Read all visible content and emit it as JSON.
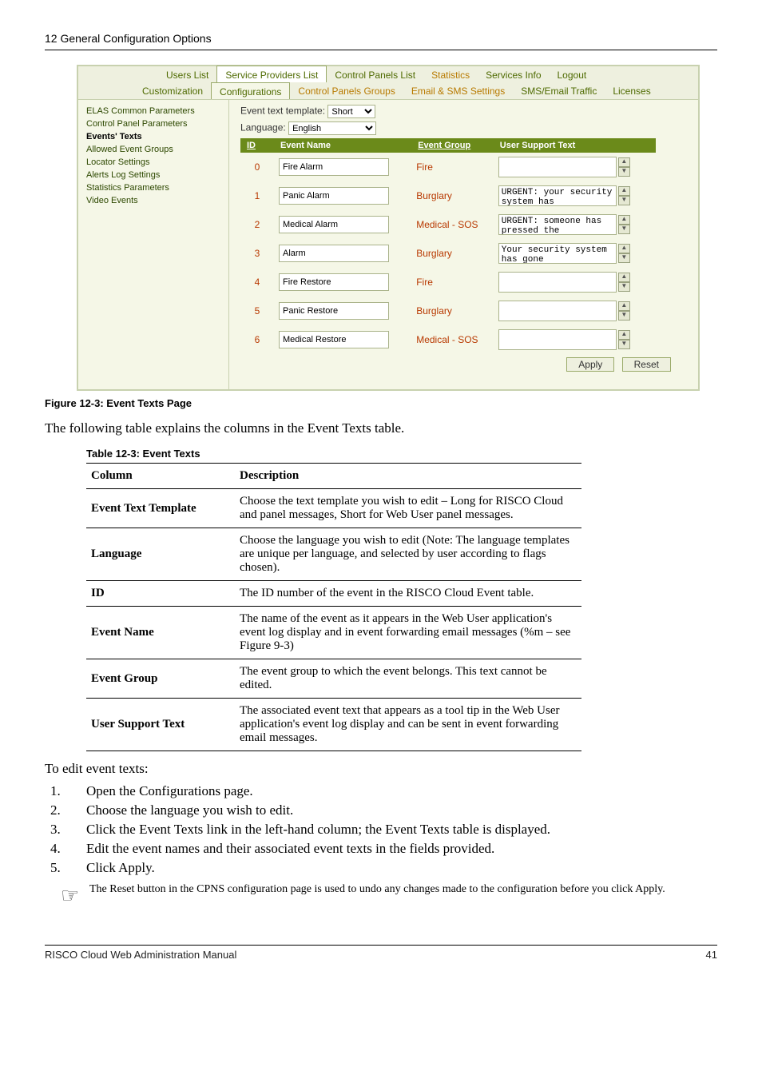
{
  "header": "12 General Configuration Options",
  "screenshot": {
    "tabs_row1": [
      "Users List",
      "Service Providers List",
      "Control Panels List",
      "Statistics",
      "Services Info",
      "Logout"
    ],
    "tabs_row2": [
      "Customization",
      "Configurations",
      "Control Panels Groups",
      "Email & SMS Settings",
      "SMS/Email Traffic",
      "Licenses"
    ],
    "sidebar": [
      {
        "label": "ELAS Common Parameters",
        "cls": ""
      },
      {
        "label": "Control Panel Parameters",
        "cls": ""
      },
      {
        "label": "Events' Texts",
        "cls": "bold"
      },
      {
        "label": "Allowed Event Groups",
        "cls": ""
      },
      {
        "label": "Locator Settings",
        "cls": ""
      },
      {
        "label": "Alerts Log Settings",
        "cls": ""
      },
      {
        "label": "Statistics Parameters",
        "cls": ""
      },
      {
        "label": "Video Events",
        "cls": ""
      }
    ],
    "template_label": "Event text template:",
    "template_value": "Short",
    "language_label": "Language:",
    "language_value": "English",
    "headers": {
      "id": "ID",
      "name": "Event Name",
      "group": "Event Group",
      "support": "User Support Text"
    },
    "rows": [
      {
        "id": "0",
        "name": "Fire Alarm",
        "group": "Fire",
        "support": ""
      },
      {
        "id": "1",
        "name": "Panic Alarm",
        "group": "Burglary",
        "support": "URGENT:  your security system has"
      },
      {
        "id": "2",
        "name": "Medical Alarm",
        "group": "Medical - SOS",
        "support": "URGENT:  someone has pressed the"
      },
      {
        "id": "3",
        "name": "Alarm",
        "group": "Burglary",
        "support": "Your security system has gone"
      },
      {
        "id": "4",
        "name": "Fire Restore",
        "group": "Fire",
        "support": ""
      },
      {
        "id": "5",
        "name": "Panic Restore",
        "group": "Burglary",
        "support": ""
      },
      {
        "id": "6",
        "name": "Medical Restore",
        "group": "Medical - SOS",
        "support": ""
      }
    ],
    "apply": "Apply",
    "reset": "Reset"
  },
  "fig_caption": "Figure 12-3: Event Texts Page",
  "intro": "The following table explains the columns in the Event Texts table.",
  "tbl_caption": "Table 12-3: Event Texts",
  "doc_table": {
    "h1": "Column",
    "h2": "Description",
    "rows": [
      {
        "c": "Event Text Template",
        "d": "Choose the text template you wish to edit – Long for RISCO Cloud and panel messages, Short for Web User panel messages."
      },
      {
        "c": "Language",
        "d": "Choose the language you wish to edit (Note: The language templates are unique per language, and selected by user according to flags chosen)."
      },
      {
        "c": "ID",
        "d": "The ID number of the event in the RISCO Cloud Event table."
      },
      {
        "c": "Event Name",
        "d": "The name of the event as it appears in the Web User application's event log display and in event forwarding email messages (%m – see Figure 9-3)"
      },
      {
        "c": "Event Group",
        "d": "The event group to which the event belongs. This text cannot be edited."
      },
      {
        "c": "User Support Text",
        "d": "The associated event text that appears as a tool tip in the Web User application's event log display and can be sent in event forwarding email messages."
      }
    ]
  },
  "steps_heading": "To edit event texts:",
  "steps": [
    "Open the Configurations page.",
    "Choose the language you wish to edit.",
    "Click the Event Texts link in the left-hand column; the Event Texts table is displayed.",
    "Edit the event names and their associated event texts in the fields provided.",
    "Click Apply."
  ],
  "note": "The Reset button in the CPNS configuration page is used to undo any changes made to the configuration before you click Apply.",
  "footer_left": "RISCO Cloud Web Administration Manual",
  "footer_page": "41"
}
